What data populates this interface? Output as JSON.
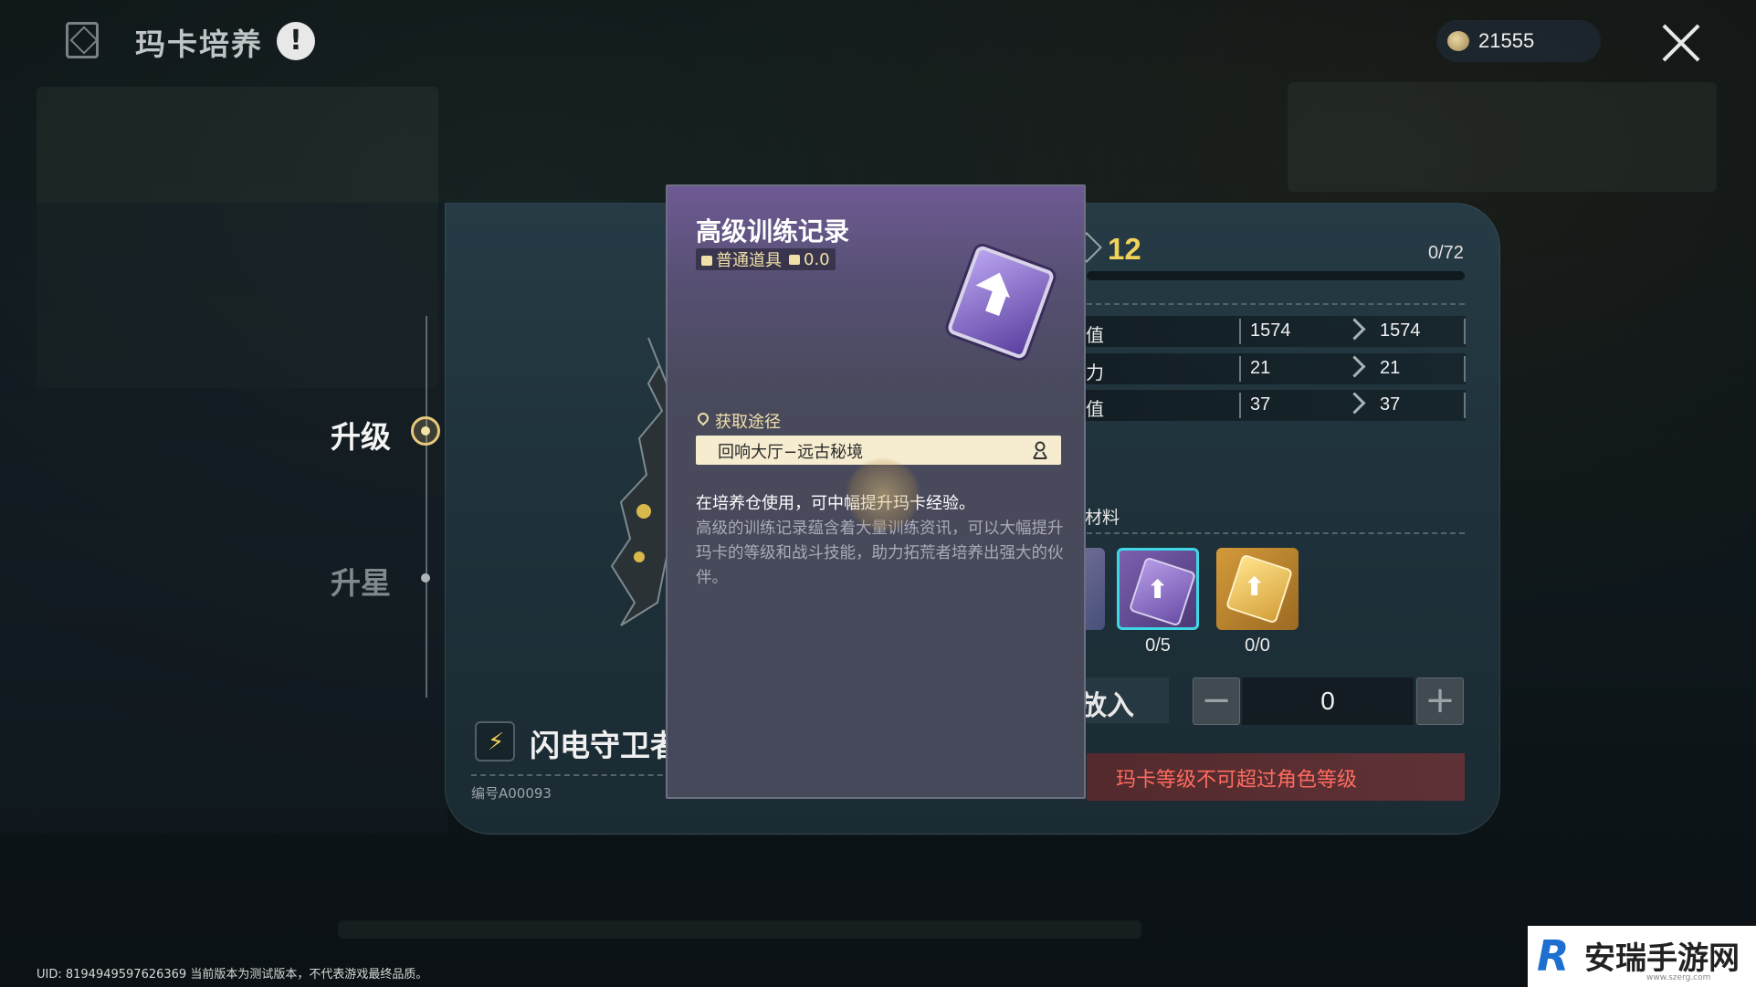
{
  "header": {
    "title": "玛卡培养",
    "alert_symbol": "!",
    "currency": "21555"
  },
  "tabs": [
    {
      "label": "升级",
      "active": true
    },
    {
      "label": "升星",
      "active": false
    }
  ],
  "card": {
    "name": "闪电守卫者",
    "code": "编号A00093"
  },
  "level": {
    "value": "12",
    "exp": "0/72"
  },
  "stats": [
    {
      "label": "值",
      "from": "1574",
      "to": "1574"
    },
    {
      "label": "力",
      "from": "21",
      "to": "21"
    },
    {
      "label": "值",
      "from": "37",
      "to": "37"
    }
  ],
  "materials": {
    "label": "材料",
    "slots": [
      {
        "rarity": "purple",
        "count": "0/5",
        "selected": true,
        "icon": "training-record-icon"
      },
      {
        "rarity": "gold",
        "count": "0/0",
        "selected": false,
        "icon": "training-record-icon"
      }
    ]
  },
  "stepper": {
    "put_in_label": "放入",
    "minus": "−",
    "value": "0",
    "plus": "+"
  },
  "warning": "玛卡等级不可超过角色等级",
  "tooltip": {
    "title": "高级训练记录",
    "tag_type": "普通道具",
    "tag_weight": "0.0",
    "source_label": "获取途径",
    "source_value": "回响大厅−远古秘境",
    "usage": "在培养仓使用，可中幅提升玛卡经验。",
    "description": "高级的训练记录蕴含着大量训练资讯，可以大幅提升玛卡的等级和战斗技能，助力拓荒者培养出强大的伙伴。"
  },
  "footer": {
    "uid": "UID: 8194949597626369 当前版本为测试版本，不代表游戏最终品质。"
  },
  "watermark": {
    "text": "安瑞手游网",
    "url": "www.szerg.com"
  },
  "colors": {
    "accent_gold": "#f2d35a",
    "warning_red": "#ff6b5f",
    "selected_cyan": "#3fd6e6"
  }
}
